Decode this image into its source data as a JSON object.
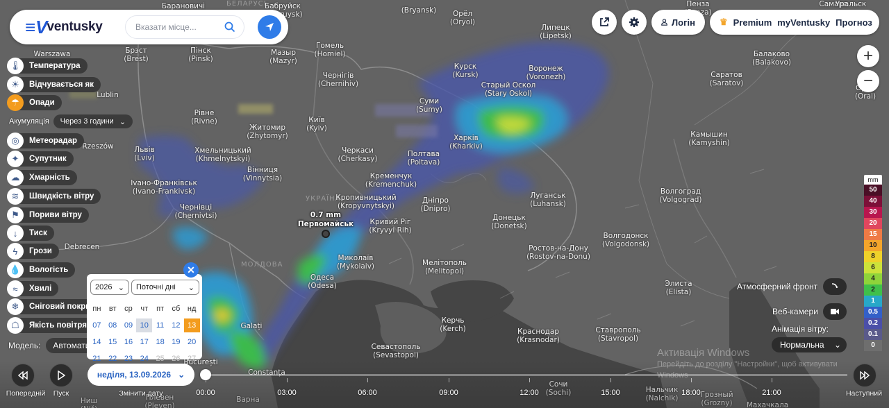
{
  "header": {
    "logo_text": "ventusky",
    "search": {
      "placeholder": "Вказати місце..."
    },
    "login_label": "Логін",
    "premium_label": "Premium",
    "myventusky_label": "myVentusky",
    "forecast_label": "Прогноз"
  },
  "layers": [
    {
      "label": "Температура",
      "icon": "thermometer-icon",
      "active": false
    },
    {
      "label": "Відчувається як",
      "icon": "feels-like-icon",
      "active": false
    },
    {
      "label": "Опади",
      "icon": "rain-drops-icon",
      "active": true
    },
    {
      "label": "Метеорадар",
      "icon": "radar-icon",
      "active": false
    },
    {
      "label": "Супутник",
      "icon": "satellite-icon",
      "active": false
    },
    {
      "label": "Хмарність",
      "icon": "cloud-icon",
      "active": false
    },
    {
      "label": "Швидкість вітру",
      "icon": "wind-icon",
      "active": false
    },
    {
      "label": "Пориви вітру",
      "icon": "wind-gust-icon",
      "active": false
    },
    {
      "label": "Тиск",
      "icon": "pressure-icon",
      "active": false
    },
    {
      "label": "Грози",
      "icon": "lightning-icon",
      "active": false
    },
    {
      "label": "Вологість",
      "icon": "humidity-icon",
      "active": false
    },
    {
      "label": "Хвилі",
      "icon": "waves-icon",
      "active": false
    },
    {
      "label": "Сніговий покри",
      "icon": "snowflake-icon",
      "active": false
    },
    {
      "label": "Якість повітря",
      "icon": "air-quality-icon",
      "active": false
    }
  ],
  "accumulation": {
    "label": "Акумуляція",
    "value": "Через 3 години"
  },
  "model": {
    "label": "Модель",
    "value": "Автомати"
  },
  "calendar": {
    "year": "2026",
    "range": "Поточні дні",
    "weekdays": [
      "пн",
      "вт",
      "ср",
      "чт",
      "пт",
      "сб",
      "нд"
    ],
    "weeks": [
      [
        "07",
        "08",
        "09",
        "10",
        "11",
        "12",
        "13"
      ],
      [
        "14",
        "15",
        "16",
        "17",
        "18",
        "19",
        "20"
      ],
      [
        "21",
        "22",
        "23",
        "24",
        "25",
        "26",
        "27"
      ]
    ],
    "today": "10",
    "selected": "13",
    "muted_days": [
      "25",
      "26",
      "27"
    ]
  },
  "timeline": {
    "date_label": "неділя, 13.09.2026",
    "change_date_label": "Змінити дату",
    "prev_label": "Попередній",
    "play_label": "Пуск",
    "next_label": "Наступний",
    "times": [
      "00:00",
      "03:00",
      "06:00",
      "09:00",
      "12:00",
      "15:00",
      "18:00",
      "21:00"
    ]
  },
  "legend": {
    "unit": "mm",
    "steps": [
      {
        "v": "50",
        "c": "#4a0f26",
        "t": "#fff"
      },
      {
        "v": "40",
        "c": "#7c1038",
        "t": "#fff"
      },
      {
        "v": "30",
        "c": "#b8164e",
        "t": "#fff"
      },
      {
        "v": "20",
        "c": "#e0465e",
        "t": "#fff"
      },
      {
        "v": "15",
        "c": "#ef7a45",
        "t": "#fff"
      },
      {
        "v": "10",
        "c": "#f3a52b",
        "t": "#222"
      },
      {
        "v": "8",
        "c": "#efd22a",
        "t": "#222"
      },
      {
        "v": "6",
        "c": "#cce23a",
        "t": "#222"
      },
      {
        "v": "4",
        "c": "#8fd43a",
        "t": "#222"
      },
      {
        "v": "2",
        "c": "#3fc04a",
        "t": "#222"
      },
      {
        "v": "1",
        "c": "#27a8c8",
        "t": "#fff"
      },
      {
        "v": "0.5",
        "c": "#3360c8",
        "t": "#fff"
      },
      {
        "v": "0.2",
        "c": "#4b4fa8",
        "t": "#fff"
      },
      {
        "v": "0.1",
        "c": "#5a5a8a",
        "t": "#fff"
      },
      {
        "v": "0",
        "c": "#6e6e6e",
        "t": "#fff"
      }
    ]
  },
  "options": {
    "front_label": "Атмосферний фронт",
    "webcam_label": "Веб-камери",
    "wind_anim_label": "Анімація вітру:",
    "wind_anim_value": "Нормальна"
  },
  "watermark": {
    "line1": "Активація Windows",
    "line2": "Перейдіть до розділу \"Настройки\", щоб активувати",
    "line3": "Windows"
  },
  "marker": {
    "value": "0.7 mm",
    "name": "Первомайськ"
  },
  "map": {
    "country_labels": [
      "БЕЛАРУСЬ",
      "УКРАЇНА",
      "МОЛДОВА"
    ],
    "cities": [
      {
        "n": "Барановичі",
        "s": ""
      },
      {
        "n": "Бабруйск",
        "s": "(Babruysk)"
      },
      {
        "n": "(Bryansk)",
        "s": ""
      },
      {
        "n": "Орёл",
        "s": "(Oryol)"
      },
      {
        "n": "Пенза",
        "s": "(Penza)"
      },
      {
        "n": "Самара",
        "s": ""
      },
      {
        "n": "Warszawa",
        "s": ""
      },
      {
        "n": "Брэст",
        "s": "(Brest)"
      },
      {
        "n": "Пінск",
        "s": "(Pinsk)"
      },
      {
        "n": "Мазыр",
        "s": "(Mazyr)"
      },
      {
        "n": "Гомель",
        "s": "(Homiel)"
      },
      {
        "n": "Липецк",
        "s": "(Lipetsk)"
      },
      {
        "n": "Балаково",
        "s": "(Balakovo)"
      },
      {
        "n": "Чернігів",
        "s": "(Chernihiv)"
      },
      {
        "n": "Курск",
        "s": "(Kursk)"
      },
      {
        "n": "Воронеж",
        "s": "(Voronezh)"
      },
      {
        "n": "Саратов",
        "s": "(Saratov)"
      },
      {
        "n": "Lublin",
        "s": ""
      },
      {
        "n": "Старый Оскол",
        "s": "(Stary Oskol)"
      },
      {
        "n": "Суми",
        "s": "(Sumy)"
      },
      {
        "n": "Рівне",
        "s": "(Rivne)"
      },
      {
        "n": "Київ",
        "s": "(Kyiv)"
      },
      {
        "n": "Житомир",
        "s": "(Zhytomyr)"
      },
      {
        "n": "Харків",
        "s": "(Kharkiv)"
      },
      {
        "n": "Камышин",
        "s": "(Kamyshin)"
      },
      {
        "n": "Rzeszów",
        "s": ""
      },
      {
        "n": "Львів",
        "s": "(Lviv)"
      },
      {
        "n": "Хмельницький",
        "s": "(Khmelnytskyi)"
      },
      {
        "n": "Черкаси",
        "s": "(Cherkasy)"
      },
      {
        "n": "Полтава",
        "s": "(Poltava)"
      },
      {
        "n": "Вінниця",
        "s": "(Vinnytsia)"
      },
      {
        "n": "Кременчук",
        "s": "(Kremenchuk)"
      },
      {
        "n": "Іvано-Франківськ",
        "s": "(Ivano-Frankivsk)"
      },
      {
        "n": "Луганськ",
        "s": "(Luhansk)"
      },
      {
        "n": "Волгоград",
        "s": "(Volgograd)"
      },
      {
        "n": "Кропивницький",
        "s": "(Kropyvnytskyi)"
      },
      {
        "n": "Дніпро",
        "s": "(Dnipro)"
      },
      {
        "n": "Чернівці",
        "s": "(Chernivtsi)"
      },
      {
        "n": "Кривий Ріг",
        "s": "(Kryvyi Rih)"
      },
      {
        "n": "Донецьк",
        "s": "(Donetsk)"
      },
      {
        "n": "Debrecen",
        "s": ""
      },
      {
        "n": "Волгодонск",
        "s": "(Volgodonsk)"
      },
      {
        "n": "Ростов-на-Дону",
        "s": "(Rostov-na-Donu)"
      },
      {
        "n": "Миколаїв",
        "s": "(Mykolaiv)"
      },
      {
        "n": "Мелітополь",
        "s": "(Melitopol)"
      },
      {
        "n": "Одеса",
        "s": "(Odesa)"
      },
      {
        "n": "Элиста",
        "s": "(Elista)"
      },
      {
        "n": "Galați",
        "s": ""
      },
      {
        "n": "Керчь",
        "s": "(Kerch)"
      },
      {
        "n": "Краснодар",
        "s": "(Krasnodar)"
      },
      {
        "n": "Ставрополь",
        "s": "(Stavropol)"
      },
      {
        "n": "Севастополь",
        "s": "(Sevastopol)"
      },
      {
        "n": "Constanța",
        "s": ""
      },
      {
        "n": "București",
        "s": ""
      },
      {
        "n": "Сочи",
        "s": "(Sochi)"
      },
      {
        "n": "Нальчик",
        "s": "(Nalchik)"
      },
      {
        "n": "Грозный",
        "s": "(Grozny)"
      },
      {
        "n": "Махачкала",
        "s": ""
      },
      {
        "n": "Плевен",
        "s": "(Pleven)"
      },
      {
        "n": "Варна",
        "s": ""
      },
      {
        "n": "Ниш",
        "s": "(Niš)"
      },
      {
        "n": "Орел",
        "s": "(Oral)"
      },
      {
        "n": "Уральск",
        "s": ""
      }
    ]
  }
}
